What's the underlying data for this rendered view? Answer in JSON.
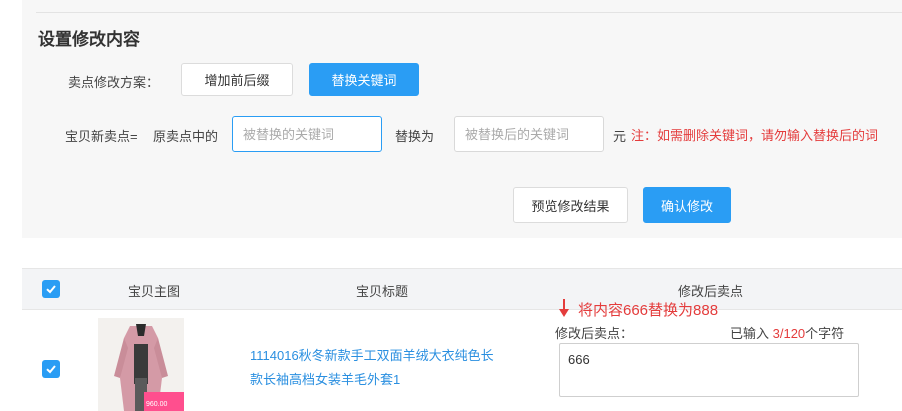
{
  "section": {
    "title": "设置修改内容"
  },
  "scheme": {
    "label": "卖点修改方案：",
    "options": [
      "增加前后缀",
      "替换关键词"
    ],
    "selected": "替换关键词"
  },
  "formula": {
    "prefix": "宝贝新卖点=",
    "source_label": "原卖点中的",
    "find_placeholder": "被替换的关键词",
    "find_value": "",
    "replace_label": "替换为",
    "replace_placeholder": "被替换后的关键词",
    "replace_value": "",
    "suffix": "元",
    "note": "注：如需删除关键词，请勿输入替换后的词"
  },
  "actions": {
    "preview": "预览修改结果",
    "confirm": "确认修改"
  },
  "table": {
    "headers": [
      "宝贝主图",
      "宝贝标题",
      "修改后卖点"
    ],
    "select_all_checked": true,
    "rows": [
      {
        "checked": true,
        "image_price": "960.00",
        "title_line1": "1114016秋冬新款手工双面羊绒大衣纯色长",
        "title_line2": "款长袖高档女装羊毛外套1",
        "after_label": "修改后卖点：",
        "count_prefix": "已输入 ",
        "count_value": "3/120",
        "count_suffix": "个字符",
        "selling_point": "666"
      }
    ]
  },
  "annotation": {
    "text": "将内容666替换为888"
  },
  "colors": {
    "accent": "#2a9df4",
    "note_red": "#e43c3c",
    "link": "#2a8fe0"
  }
}
